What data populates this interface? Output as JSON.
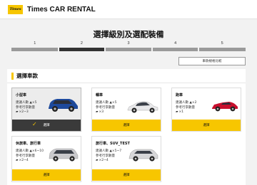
{
  "header": {
    "logo_text": "Times",
    "brand": "Times CAR RENTAL"
  },
  "page_title": "選擇級別及選配裝備",
  "steps": [
    "1",
    "2",
    "3",
    "4",
    "5"
  ],
  "active_step": 2,
  "compare_button": "車款規格比較",
  "section_title": "選擇車款",
  "colors": {
    "accent": "#f7c600",
    "selected_button": "#3a3a3a"
  },
  "cards": [
    {
      "name": "小型車",
      "seats": "建議人數 ▲×5",
      "luggage_label": "參考行李數量",
      "luggage": "×2~3",
      "button": "選擇",
      "selected": true,
      "car_color": "#1e4a9c"
    },
    {
      "name": "轎車",
      "seats": "建議人數 ▲×5",
      "luggage_label": "參考行李數量",
      "luggage": "×3",
      "button": "選擇",
      "selected": false,
      "car_color": "#e8e8ea"
    },
    {
      "name": "跑車",
      "seats": "建議人數 ▲×2",
      "luggage_label": "參考行李數量",
      "luggage": "×1",
      "button": "選擇",
      "selected": false,
      "car_color": "#c8102e"
    },
    {
      "name": "休旅車、旅行車",
      "seats": "建議人數 ▲×6~10",
      "luggage_label": "參考行李數量",
      "luggage": "×2~4",
      "button": "選擇",
      "selected": false,
      "car_color": "#c9c9cc"
    },
    {
      "name": "旅行車、SUV_TEST",
      "seats": "建議人數 ▲×5~7",
      "luggage_label": "參考行李數量",
      "luggage": "×2~4",
      "button": "選擇",
      "selected": false,
      "car_color": "#d6d6d8"
    }
  ]
}
